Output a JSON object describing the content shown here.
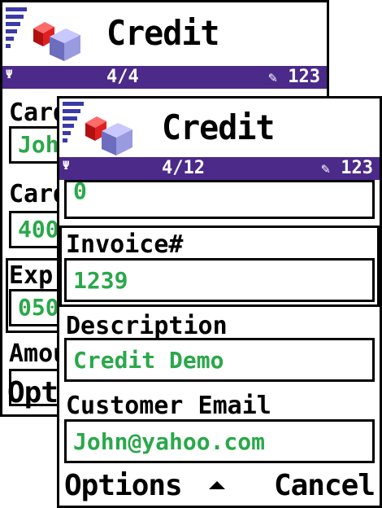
{
  "back_screen": {
    "title": "Credit",
    "pager": "4/4",
    "mode": "123",
    "labels": [
      "Card",
      "Card",
      "Exp",
      "Amount"
    ],
    "values": [
      "John",
      "400",
      "050"
    ],
    "softkey_left": "Options"
  },
  "front_screen": {
    "title": "Credit",
    "pager": "4/12",
    "mode": "123",
    "partial_value": "0",
    "fields": [
      {
        "label": "Invoice#",
        "value": "1239"
      },
      {
        "label": "Description",
        "value": "Credit Demo"
      },
      {
        "label": "Customer Email",
        "value": "John@yahoo.com"
      }
    ],
    "softkey_left": "Options",
    "softkey_right": "Cancel"
  },
  "colors": {
    "accent_bar": "#4b2a8a",
    "value_text": "#2aa84a"
  },
  "icons": {
    "app_icon": "stacked-cubes-icon",
    "signal": "signal-strength-icon",
    "antenna": "antenna-icon",
    "pen": "pen-icon",
    "scroll_up": "up-arrow-icon"
  }
}
